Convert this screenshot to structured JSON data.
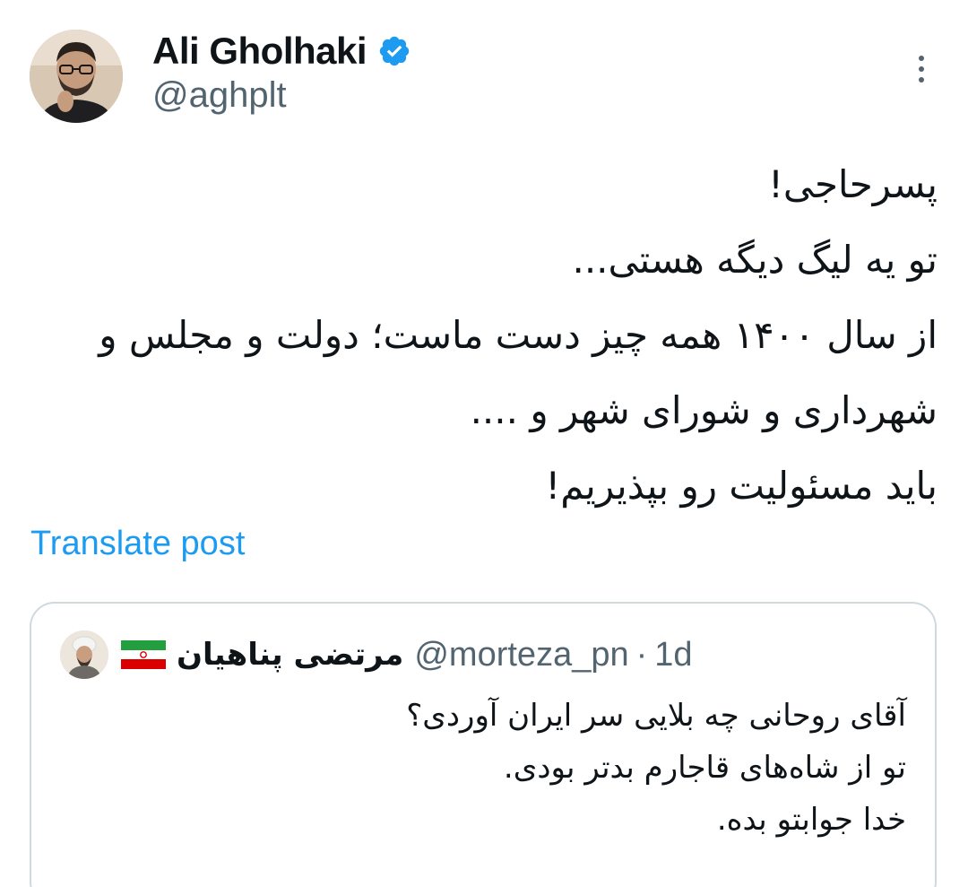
{
  "author": {
    "display_name": "Ali Gholhaki",
    "handle": "@aghplt",
    "verified": true,
    "avatar_icon": "profile-photo"
  },
  "more_icon": "more-vertical-icon",
  "post": {
    "lines": [
      "پسرحاجی!",
      "تو یه لیگ دیگه هستی...",
      "از سال ۱۴۰۰ همه چیز دست ماست؛ دولت و مجلس و",
      "شهرداری و شورای شهر و ....",
      "باید مسئولیت رو بپذیریم!"
    ]
  },
  "translate_label": "Translate post",
  "quote": {
    "display_name": "مرتضی پناهیان",
    "handle": "@morteza_pn",
    "separator": "·",
    "time": "1d",
    "flag_icon": "iran-flag-icon",
    "lines": [
      "آقای روحانی چه بلایی سر ایران آوردی؟",
      "تو از شاه‌های قاجارم بدتر بودی.",
      "خدا جوابتو بده."
    ]
  },
  "colors": {
    "text": "#0f1419",
    "secondary": "#536471",
    "link": "#1d9bf0",
    "border": "#cfd9de",
    "verified": "#1d9bf0"
  }
}
